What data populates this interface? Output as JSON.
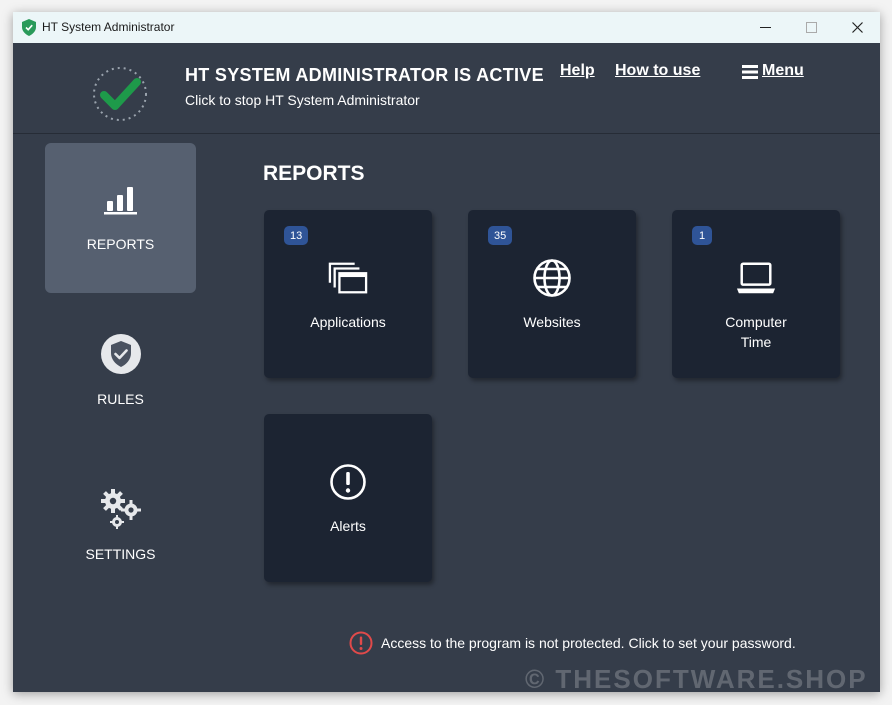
{
  "window": {
    "title": "HT System Administrator",
    "controls": {
      "minimize": "—",
      "maximize": "☐",
      "close": "✕"
    }
  },
  "header": {
    "status_title": "HT SYSTEM ADMINISTRATOR IS ACTIVE",
    "status_subtitle": "Click to stop HT System Administrator",
    "links": {
      "help": "Help",
      "how_to_use": "How to use",
      "menu": "Menu"
    }
  },
  "sidebar": {
    "items": [
      {
        "label": "REPORTS",
        "icon": "bar-chart-icon",
        "active": true
      },
      {
        "label": "RULES",
        "icon": "shield-check-icon",
        "active": false
      },
      {
        "label": "SETTINGS",
        "icon": "gears-icon",
        "active": false
      }
    ]
  },
  "main": {
    "section_title": "REPORTS",
    "tiles": [
      {
        "label": "Applications",
        "badge": "13",
        "icon": "windows-stack-icon"
      },
      {
        "label": "Websites",
        "badge": "35",
        "icon": "globe-icon"
      },
      {
        "label_line1": "Computer",
        "label_line2": "Time",
        "badge": "1",
        "icon": "laptop-icon"
      },
      {
        "label": "Alerts",
        "icon": "alert-circle-icon"
      }
    ]
  },
  "footer": {
    "message": "Access to the program is not protected. Click to set your password.",
    "watermark": "© THESOFTWARE.SHOP"
  },
  "colors": {
    "background": "#353d4a",
    "tile": "#1c2432",
    "active_sidebar": "#566070",
    "badge": "#2f5497",
    "check": "#1e9a4a",
    "warning": "#e04a4a"
  }
}
